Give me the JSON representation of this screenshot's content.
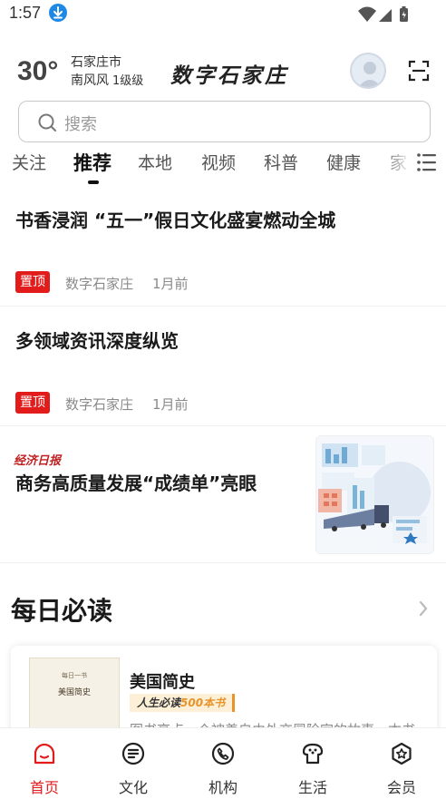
{
  "status_bar": {
    "time": "1:57"
  },
  "header": {
    "temperature": "30°",
    "city": "石家庄市",
    "wind": "南风风",
    "wind_level": "1级级",
    "logo_text": "数字石家庄"
  },
  "search": {
    "placeholder": "搜索"
  },
  "tabs": [
    "关注",
    "推荐",
    "本地",
    "视频",
    "科普",
    "健康",
    "家"
  ],
  "active_tab": "推荐",
  "news": [
    {
      "title": "书香浸润 “五一”假日文化盛宴燃动全城",
      "badge": "置顶",
      "source": "数字石家庄",
      "time": "1月前"
    },
    {
      "title": "多领域资讯深度纵览",
      "badge": "置顶",
      "source": "数字石家庄",
      "time": "1月前"
    }
  ],
  "news_featured": {
    "source": "经济日报",
    "title": "商务高质量发展“成绩单”亮眼"
  },
  "daily": {
    "title": "每日必读",
    "book": {
      "cover_small": "每日一书",
      "cover_title": "美国简史",
      "title": "美国简史",
      "tag_prefix": "人生必读",
      "tag_highlight": "500本书",
      "description": "图书亮点一个被羡自由外交冒险家的故事一本书"
    }
  },
  "bottom_nav": [
    {
      "label": "首页",
      "icon": "home-icon",
      "active": true
    },
    {
      "label": "文化",
      "icon": "culture-icon",
      "active": false
    },
    {
      "label": "机构",
      "icon": "phone-icon",
      "active": false
    },
    {
      "label": "生活",
      "icon": "life-icon",
      "active": false
    },
    {
      "label": "会员",
      "icon": "member-icon",
      "active": false
    }
  ],
  "colors": {
    "accent": "#e21b1b",
    "badge": "#e21b1b",
    "source_red": "#c02020",
    "tag_orange": "#e8932b"
  }
}
